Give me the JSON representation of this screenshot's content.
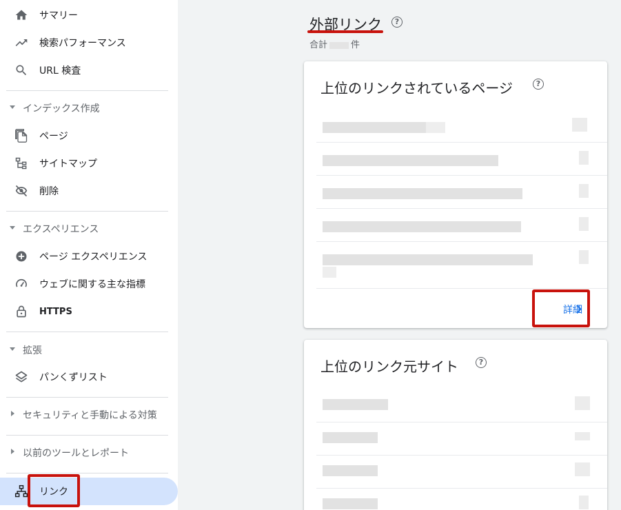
{
  "sidebar": {
    "items": [
      {
        "label": "サマリー",
        "icon": "home-icon"
      },
      {
        "label": "検索パフォーマンス",
        "icon": "trending-up-icon"
      },
      {
        "label": "URL 検査",
        "icon": "search-icon"
      }
    ],
    "sections": [
      {
        "label": "インデックス作成",
        "expanded": true,
        "items": [
          {
            "label": "ページ",
            "icon": "pages-icon"
          },
          {
            "label": "サイトマップ",
            "icon": "sitemap-icon"
          },
          {
            "label": "削除",
            "icon": "visibility-off-icon"
          }
        ]
      },
      {
        "label": "エクスペリエンス",
        "expanded": true,
        "items": [
          {
            "label": "ページ エクスペリエンス",
            "icon": "add-circle-icon"
          },
          {
            "label": "ウェブに関する主な指標",
            "icon": "speed-gauge-icon"
          },
          {
            "label": "HTTPS",
            "icon": "lock-icon"
          }
        ]
      },
      {
        "label": "拡張",
        "expanded": true,
        "items": [
          {
            "label": "パンくずリスト",
            "icon": "layers-icon"
          }
        ]
      },
      {
        "label": "セキュリティと手動による対策",
        "expanded": false
      },
      {
        "label": "以前のツールとレポート",
        "expanded": false
      }
    ],
    "active": {
      "label": "リンク",
      "icon": "links-icon"
    }
  },
  "main": {
    "title": "外部リンク",
    "total_prefix": "合計",
    "total_suffix": "件",
    "cards": [
      {
        "title": "上位のリンクされているページ",
        "details_label": "詳細"
      },
      {
        "title": "上位のリンク元サイト"
      }
    ]
  },
  "colors": {
    "accent": "#1a73e8",
    "highlight": "#c8120c",
    "active_bg": "#d3e3fd"
  }
}
